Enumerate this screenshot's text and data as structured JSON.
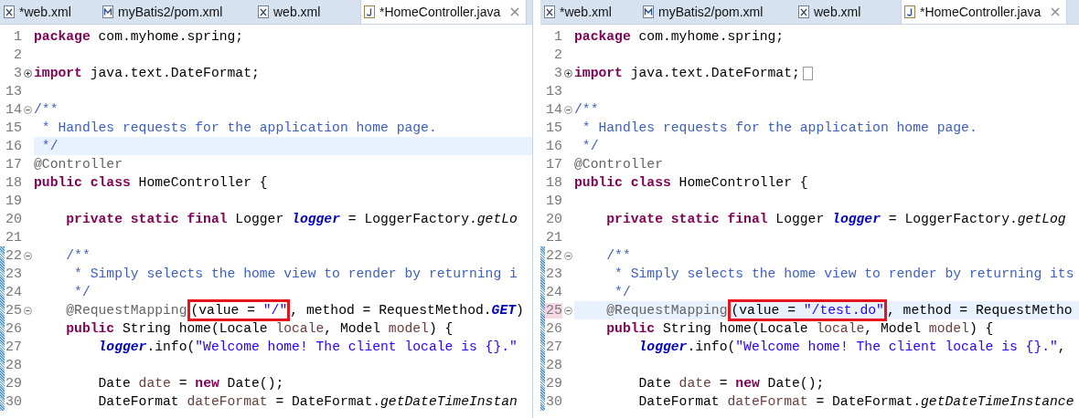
{
  "panels": [
    {
      "tabs": [
        {
          "label": "*web.xml",
          "kind": "xml",
          "selected": false
        },
        {
          "label": "myBatis2/pom.xml",
          "kind": "maven",
          "selected": false
        },
        {
          "label": "web.xml",
          "kind": "xml",
          "selected": false
        },
        {
          "label": "*HomeController.java",
          "kind": "java",
          "selected": true
        }
      ],
      "lines": [
        {
          "number": "1",
          "tokens": [
            {
              "kind": "keyword",
              "text": "package"
            },
            {
              "kind": "plain",
              "text": " com.myhome.spring;"
            }
          ]
        },
        {
          "number": "2"
        },
        {
          "number": "3",
          "folded": true,
          "tokens": [
            {
              "kind": "keyword",
              "text": "import"
            },
            {
              "kind": "plain",
              "text": " java.text.DateFormat;"
            }
          ]
        },
        {
          "number": "13"
        },
        {
          "number": "14",
          "folded": false,
          "tokens": [
            {
              "kind": "comment",
              "text": "/**"
            }
          ]
        },
        {
          "number": "15",
          "tokens": [
            {
              "kind": "comment",
              "text": " * Handles requests for the application home page."
            }
          ]
        },
        {
          "number": "16",
          "current": true,
          "tokens": [
            {
              "kind": "comment",
              "text": " */"
            }
          ]
        },
        {
          "number": "17",
          "tokens": [
            {
              "kind": "annotation",
              "text": "@Controller"
            }
          ]
        },
        {
          "number": "18",
          "tokens": [
            {
              "kind": "keyword",
              "text": "public class"
            },
            {
              "kind": "plain",
              "text": " HomeController {"
            }
          ]
        },
        {
          "number": "19"
        },
        {
          "number": "20",
          "tokens": [
            {
              "kind": "keyword",
              "text": "    private static final"
            },
            {
              "kind": "plain",
              "text": " Logger "
            },
            {
              "kind": "field",
              "text": "logger"
            },
            {
              "kind": "plain",
              "text": " = LoggerFactory."
            },
            {
              "kind": "static",
              "text": "getLo"
            }
          ]
        },
        {
          "number": "21"
        },
        {
          "number": "22",
          "folded": false,
          "changed": true,
          "tokens": [
            {
              "kind": "comment",
              "text": "    /**"
            }
          ]
        },
        {
          "number": "23",
          "changed": true,
          "tokens": [
            {
              "kind": "comment",
              "text": "     * Simply selects the home view to render by returning i"
            }
          ]
        },
        {
          "number": "24",
          "changed": true,
          "tokens": [
            {
              "kind": "comment",
              "text": "     */"
            }
          ]
        },
        {
          "number": "25",
          "folded": false,
          "changed": true,
          "tokens": [
            {
              "kind": "annotation",
              "text": "    @RequestMapping"
            },
            {
              "kind": "plain",
              "text": "(value = ",
              "boxed": true
            },
            {
              "kind": "string",
              "text": "\"/\"",
              "boxed": true
            },
            {
              "kind": "plain",
              "text": ", method = RequestMethod."
            },
            {
              "kind": "field",
              "text": "GET"
            },
            {
              "kind": "plain",
              "text": ")"
            }
          ]
        },
        {
          "number": "26",
          "changed": true,
          "tokens": [
            {
              "kind": "keyword",
              "text": "    public"
            },
            {
              "kind": "plain",
              "text": " String home(Locale "
            },
            {
              "kind": "local",
              "text": "locale"
            },
            {
              "kind": "plain",
              "text": ", Model "
            },
            {
              "kind": "local",
              "text": "model"
            },
            {
              "kind": "plain",
              "text": ") {"
            }
          ]
        },
        {
          "number": "27",
          "changed": true,
          "tokens": [
            {
              "kind": "field",
              "text": "        logger"
            },
            {
              "kind": "plain",
              "text": ".info("
            },
            {
              "kind": "string",
              "text": "\"Welcome home! The client locale is {}.\""
            }
          ]
        },
        {
          "number": "28",
          "changed": true
        },
        {
          "number": "29",
          "changed": true,
          "tokens": [
            {
              "kind": "plain",
              "text": "        Date "
            },
            {
              "kind": "local",
              "text": "date"
            },
            {
              "kind": "plain",
              "text": " = "
            },
            {
              "kind": "keyword",
              "text": "new"
            },
            {
              "kind": "plain",
              "text": " Date();"
            }
          ]
        },
        {
          "number": "30",
          "changed": true,
          "tokens": [
            {
              "kind": "plain",
              "text": "        DateFormat "
            },
            {
              "kind": "local",
              "text": "dateFormat"
            },
            {
              "kind": "plain",
              "text": " = DateFormat."
            },
            {
              "kind": "static",
              "text": "getDateTimeInstan"
            }
          ]
        }
      ]
    },
    {
      "tabs": [
        {
          "label": "*web.xml",
          "kind": "xml",
          "selected": false
        },
        {
          "label": "myBatis2/pom.xml",
          "kind": "maven",
          "selected": false
        },
        {
          "label": "web.xml",
          "kind": "xml",
          "selected": false
        },
        {
          "label": "*HomeController.java",
          "kind": "java",
          "selected": true
        }
      ],
      "lines": [
        {
          "number": "1",
          "tokens": [
            {
              "kind": "keyword",
              "text": "package"
            },
            {
              "kind": "plain",
              "text": " com.myhome.spring;"
            }
          ]
        },
        {
          "number": "2"
        },
        {
          "number": "3",
          "folded": true,
          "fold_hint": true,
          "tokens": [
            {
              "kind": "keyword",
              "text": "import"
            },
            {
              "kind": "plain",
              "text": " java.text.DateFormat;"
            }
          ]
        },
        {
          "number": "13"
        },
        {
          "number": "14",
          "folded": false,
          "tokens": [
            {
              "kind": "comment",
              "text": "/**"
            }
          ]
        },
        {
          "number": "15",
          "tokens": [
            {
              "kind": "comment",
              "text": " * Handles requests for the application home page."
            }
          ]
        },
        {
          "number": "16",
          "tokens": [
            {
              "kind": "comment",
              "text": " */"
            }
          ]
        },
        {
          "number": "17",
          "tokens": [
            {
              "kind": "annotation",
              "text": "@Controller"
            }
          ]
        },
        {
          "number": "18",
          "tokens": [
            {
              "kind": "keyword",
              "text": "public class"
            },
            {
              "kind": "plain",
              "text": " HomeController {"
            }
          ]
        },
        {
          "number": "19"
        },
        {
          "number": "20",
          "tokens": [
            {
              "kind": "keyword",
              "text": "    private static final"
            },
            {
              "kind": "plain",
              "text": " Logger "
            },
            {
              "kind": "field",
              "text": "logger"
            },
            {
              "kind": "plain",
              "text": " = LoggerFactory."
            },
            {
              "kind": "static",
              "text": "getLog"
            }
          ]
        },
        {
          "number": "21"
        },
        {
          "number": "22",
          "folded": false,
          "changed": true,
          "tokens": [
            {
              "kind": "comment",
              "text": "    /**"
            }
          ]
        },
        {
          "number": "23",
          "changed": true,
          "tokens": [
            {
              "kind": "comment",
              "text": "     * Simply selects the home view to render by returning its"
            }
          ]
        },
        {
          "number": "24",
          "changed": true,
          "tokens": [
            {
              "kind": "comment",
              "text": "     */"
            }
          ]
        },
        {
          "number": "25",
          "folded": false,
          "changed": true,
          "current": true,
          "tokens": [
            {
              "kind": "annotation",
              "text": "    @RequestMapping"
            },
            {
              "kind": "plain",
              "text": "(value = ",
              "boxed": true
            },
            {
              "kind": "string",
              "text": "\"/test.do\"",
              "boxed": true
            },
            {
              "kind": "plain",
              "text": ", method = RequestMetho"
            }
          ]
        },
        {
          "number": "26",
          "changed": true,
          "tokens": [
            {
              "kind": "keyword",
              "text": "    public"
            },
            {
              "kind": "plain",
              "text": " String home(Locale "
            },
            {
              "kind": "local",
              "text": "locale"
            },
            {
              "kind": "plain",
              "text": ", Model "
            },
            {
              "kind": "local",
              "text": "model"
            },
            {
              "kind": "plain",
              "text": ") {"
            }
          ]
        },
        {
          "number": "27",
          "changed": true,
          "tokens": [
            {
              "kind": "field",
              "text": "        logger"
            },
            {
              "kind": "plain",
              "text": ".info("
            },
            {
              "kind": "string",
              "text": "\"Welcome home! The client locale is {}.\""
            },
            {
              "kind": "plain",
              "text": ","
            }
          ]
        },
        {
          "number": "28",
          "changed": true
        },
        {
          "number": "29",
          "changed": true,
          "tokens": [
            {
              "kind": "plain",
              "text": "        Date "
            },
            {
              "kind": "local",
              "text": "date"
            },
            {
              "kind": "plain",
              "text": " = "
            },
            {
              "kind": "keyword",
              "text": "new"
            },
            {
              "kind": "plain",
              "text": " Date();"
            }
          ]
        },
        {
          "number": "30",
          "changed": true,
          "tokens": [
            {
              "kind": "plain",
              "text": "        DateFormat "
            },
            {
              "kind": "local",
              "text": "dateFormat"
            },
            {
              "kind": "plain",
              "text": " = DateFormat."
            },
            {
              "kind": "static",
              "text": "getDateTimeInstance"
            }
          ]
        }
      ]
    }
  ]
}
